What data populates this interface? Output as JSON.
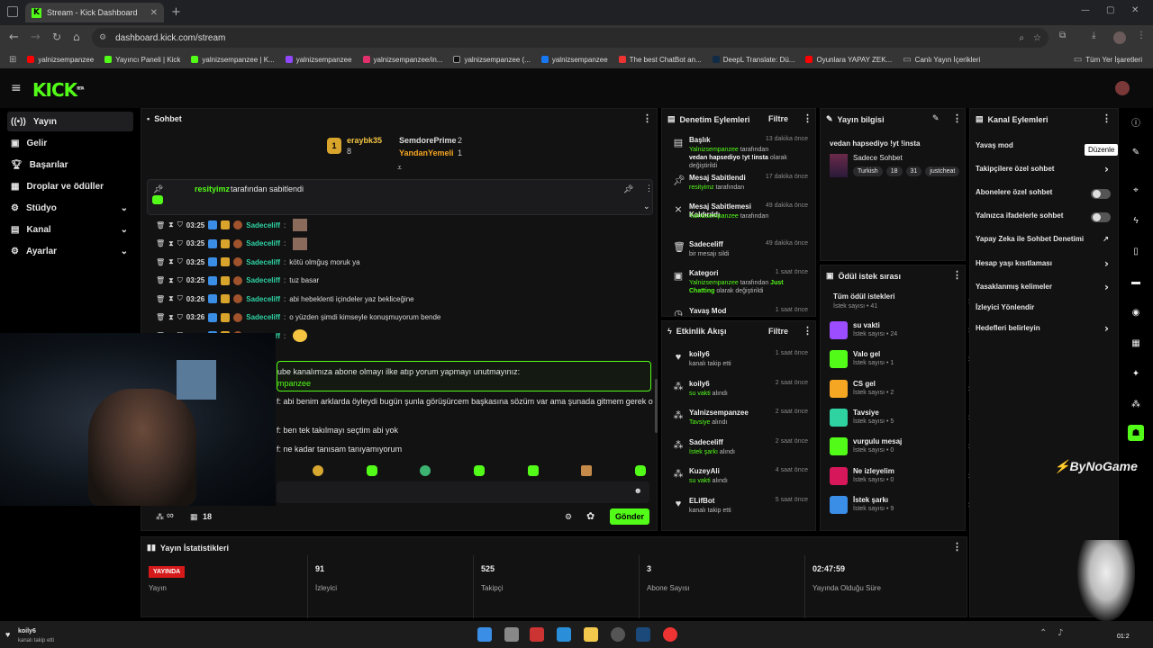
{
  "browser": {
    "tab_title": "Stream - Kick Dashboard",
    "url": "dashboard.kick.com/stream"
  },
  "bookmarks": [
    "yalnizsempanzee",
    "Yayıncı Paneli | Kick",
    "yalnizsempanzee | K...",
    "yalnizsempanzee",
    "yalnizsempanzee/in...",
    "yalnizsempanzee (...",
    "yalnizsempanzee",
    "The best ChatBot an...",
    "DeepL Translate: Dü...",
    "Oyunlara YAPAY ZEK...",
    "Canlı Yayın İçerikleri",
    "Tüm Yer İşaretleri"
  ],
  "app": {
    "logo": "KICK",
    "logo_sup": "BETA"
  },
  "sidebar": [
    {
      "label": "Yayın",
      "icon": "broadcast-icon"
    },
    {
      "label": "Gelir",
      "icon": "money-icon"
    },
    {
      "label": "Başarılar",
      "icon": "trophy-icon"
    },
    {
      "label": "Droplar ve ödüller",
      "icon": "gift-icon"
    },
    {
      "label": "Stüdyo",
      "icon": "studio-icon"
    },
    {
      "label": "Kanal",
      "icon": "channel-icon"
    },
    {
      "label": "Ayarlar",
      "icon": "gear-icon"
    }
  ],
  "chat": {
    "title": "Sohbet",
    "leaders": {
      "first": {
        "name": "eraybk35",
        "count": "8",
        "rank": "1"
      },
      "second": {
        "name": "SemdorePrime",
        "count": "2"
      },
      "third": {
        "name": "YandanYemeli",
        "count": "1"
      }
    },
    "pinned": {
      "user": "resityimz",
      "text": "tarafından sabitlendi"
    },
    "messages": [
      {
        "time": "03:25",
        "user": "Sadeceliff",
        "text": ""
      },
      {
        "time": "03:25",
        "user": "Sadeceliff",
        "text": ""
      },
      {
        "time": "03:25",
        "user": "Sadeceliff",
        "text": "kötü olmğuş moruk ya"
      },
      {
        "time": "03:25",
        "user": "Sadeceliff",
        "text": "tuz basar"
      },
      {
        "time": "03:26",
        "user": "Sadeceliff",
        "text": "abi hebeklenti içindeler yaz bekliceğine"
      },
      {
        "time": "03:26",
        "user": "Sadeceliff",
        "text": "o yüzden şimdi kimseyle konuşmuyorum bende"
      },
      {
        "time": "03:26",
        "user": "Sadeceliff",
        "text": ""
      }
    ],
    "highlight": {
      "line1": "ube kanalımıza abone olmayı ilke atıp yorum yapmayı unutmayınız:",
      "line2": "mpanzee"
    },
    "partial": [
      "f: abi benim arklarda öyleydi bugün şunla görüşürcem başkasına sözüm var ama şunada gitmem gerek o var bu",
      "f: ben tek takılmayı seçtim abi yok",
      "f: ne kadar tanısam tanıyamıyorum"
    ],
    "infinity": "∞",
    "viewers": "18",
    "send": "Gönder"
  },
  "mod_actions": {
    "title": "Denetim Eylemleri",
    "filter": "Filtre",
    "items": [
      {
        "title": "Başlık",
        "time": "13 dakika önce",
        "by": "Yalnizsempanzee",
        "rest": " tarafından ",
        "val": "vedan hapsediyo !yt !insta",
        "tail": " olarak değiştirildi",
        "icon": "list-icon"
      },
      {
        "title": "Mesaj Sabitlendi",
        "time": "17 dakika önce",
        "by": "resityimz",
        "rest": " tarafından",
        "val": "",
        "tail": "",
        "icon": "pin-icon"
      },
      {
        "title": "Mesaj Sabitlemesi Kaldırıldı",
        "time": "49 dakika önce",
        "by": "Yalnizsempanzee",
        "rest": " tarafından",
        "val": "",
        "tail": "",
        "icon": "unpin-icon"
      },
      {
        "title": "Sadeceliff",
        "time": "49 dakika önce",
        "by": "",
        "rest": "bir mesajı sildi",
        "val": "",
        "tail": "",
        "icon": "trash-icon"
      },
      {
        "title": "Kategori",
        "time": "1 saat önce",
        "by": "Yalnizsempanzee",
        "rest": " tarafından ",
        "val": "Just Chatting",
        "tail": " olarak değiştirildi",
        "icon": "category-icon"
      },
      {
        "title": "Yavaş Mod",
        "time": "1 saat önce",
        "by": "",
        "rest": "",
        "val": "",
        "tail": "",
        "icon": "clock-icon"
      }
    ]
  },
  "activity": {
    "title": "Etkinlik Akışı",
    "filter": "Filtre",
    "items": [
      {
        "name": "koily6",
        "time": "1 saat önce",
        "sub": "kanalı takip etti",
        "hl": "",
        "icon": "heart-icon"
      },
      {
        "name": "koily6",
        "time": "2 saat önce",
        "sub": " alındı",
        "hl": "su vakti",
        "icon": "reward-icon"
      },
      {
        "name": "Yalnizsempanzee",
        "time": "2 saat önce",
        "sub": " alındı",
        "hl": "Tavsiye",
        "icon": "reward-icon"
      },
      {
        "name": "Sadeceliff",
        "time": "2 saat önce",
        "sub": " alındı",
        "hl": "İstek şarkı",
        "icon": "reward-icon"
      },
      {
        "name": "KuzeyAli",
        "time": "4 saat önce",
        "sub": " alındı",
        "hl": "su vakti",
        "icon": "reward-icon"
      },
      {
        "name": "ELifBot",
        "time": "5 saat önce",
        "sub": "kanalı takip etti",
        "hl": "",
        "icon": "heart-icon"
      }
    ]
  },
  "stream_info": {
    "title": "Yayın bilgisi",
    "stream_title": "vedan hapsediyo !yt !insta",
    "category": "Sadece Sohbet",
    "tags": [
      "Turkish",
      "18",
      "31",
      "justcheat"
    ]
  },
  "rewards": {
    "title": "Ödül istek sırası",
    "all": {
      "name": "Tüm ödül istekleri",
      "count": "İstek sayısı • 41"
    },
    "items": [
      {
        "name": "su vakti",
        "count": "İstek sayısı • 24",
        "color": "#9b4dff"
      },
      {
        "name": "Valo gel",
        "count": "İstek sayısı • 1",
        "color": "#53fc18"
      },
      {
        "name": "CS gel",
        "count": "İstek sayısı • 2",
        "color": "#f5a623"
      },
      {
        "name": "Tavsiye",
        "count": "İstek sayısı • 5",
        "color": "#2fd3a2"
      },
      {
        "name": "vurgulu mesaj",
        "count": "İstek sayısı • 0",
        "color": "#53fc18"
      },
      {
        "name": "Ne izleyelim",
        "count": "İstek sayısı • 0",
        "color": "#d6175a"
      },
      {
        "name": "İstek şarkı",
        "count": "İstek sayısı • 9",
        "color": "#3a8ee6"
      }
    ]
  },
  "channel_actions": {
    "title": "Kanal Eylemleri",
    "tooltip": "Düzenle",
    "items": [
      {
        "label": "Yavaş mod",
        "ctl": "none"
      },
      {
        "label": "Takipçilere özel sohbet",
        "ctl": "chevron"
      },
      {
        "label": "Abonelere özel sohbet",
        "ctl": "toggle"
      },
      {
        "label": "Yalnızca ifadelerle sohbet",
        "ctl": "toggle"
      },
      {
        "label": "Yapay Zeka ile Sohbet Denetimi",
        "ctl": "external"
      },
      {
        "label": "Hesap yaşı kısıtlaması",
        "ctl": "chevron"
      },
      {
        "label": "Yasaklanmış kelimeler",
        "ctl": "chevron"
      },
      {
        "label": "İzleyici Yönlendir",
        "ctl": "none"
      },
      {
        "label": "Hedefleri belirleyin",
        "ctl": "chevron"
      }
    ]
  },
  "stats": {
    "title": "Yayın İstatistikleri",
    "live": "YAYINDA",
    "cells": [
      {
        "value": "",
        "label": "Yayın"
      },
      {
        "value": "91",
        "label": "İzleyici"
      },
      {
        "value": "525",
        "label": "Takipçi"
      },
      {
        "value": "3",
        "label": "Abone Sayısı"
      },
      {
        "value": "02:47:59",
        "label": "Yayında Olduğu Süre"
      }
    ]
  },
  "overlay": {
    "brand": "ByNoGame"
  },
  "notification": {
    "user": "koily6",
    "text": "kanalı takip etti"
  },
  "taskbar": {
    "clock": "01:2"
  }
}
